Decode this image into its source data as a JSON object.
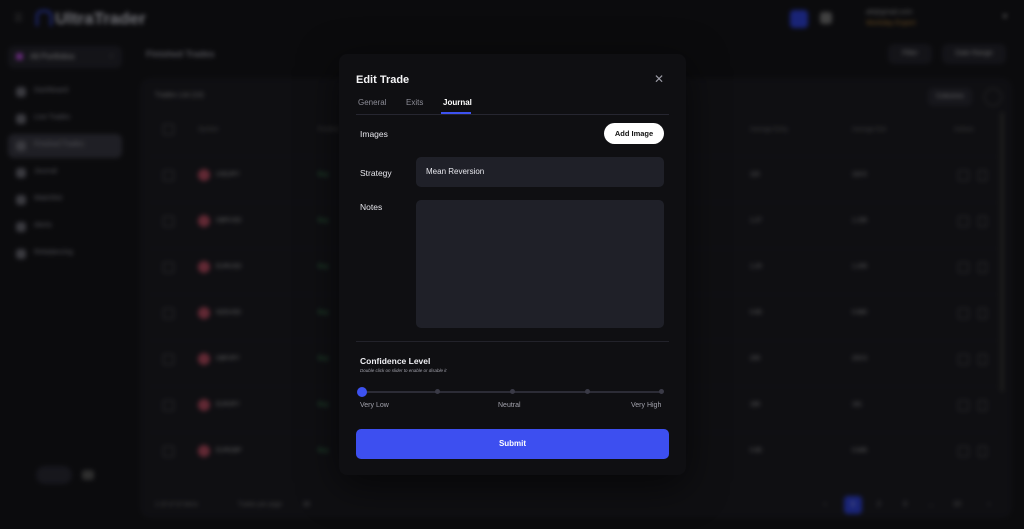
{
  "app": {
    "brand": "UltraTrader",
    "user_email": "alt@gmail.com",
    "user_plan": "Workday Expert",
    "portfolio": "All Portfolios",
    "page_title": "Finished Trades",
    "header_buttons": [
      "Filter",
      "Date Range"
    ],
    "sidebar": [
      {
        "label": "Dashboard"
      },
      {
        "label": "Live Trades"
      },
      {
        "label": "Finished Trades"
      },
      {
        "label": "Journal"
      },
      {
        "label": "Watchlist"
      },
      {
        "label": "Alerts"
      },
      {
        "label": "Rebalancing"
      }
    ],
    "table": {
      "title": "Trades List (10)",
      "columns_button": "Columns",
      "headers": [
        "Symbol",
        "Position",
        "Average Entry",
        "Average Exit",
        "Actions"
      ],
      "rows": [
        {
          "symbol": "USDJPY",
          "side": "Buy",
          "entry": "115",
          "exit": "116.5"
        },
        {
          "symbol": "GBPUSD",
          "side": "Buy",
          "entry": "1.27",
          "exit": "1.235"
        },
        {
          "symbol": "EURUSD",
          "side": "Buy",
          "entry": "1.20",
          "exit": "1.205"
        },
        {
          "symbol": "NZDUSD",
          "side": "Buy",
          "entry": "0.65",
          "exit": "0.660"
        },
        {
          "symbol": "GBPJPY",
          "side": "Buy",
          "entry": "205",
          "exit": "203.5"
        },
        {
          "symbol": "EURJPY",
          "side": "Buy",
          "entry": "165",
          "exit": "161"
        },
        {
          "symbol": "EURGBP",
          "side": "Buy",
          "entry": "0.85",
          "exit": "0.845"
        }
      ],
      "pagination_text": "1-10 of 10 items",
      "rows_per_page_label": "Trades per page",
      "rows_per_page_value": "10",
      "pages": [
        "1",
        "2",
        "3",
        "...",
        "10"
      ]
    }
  },
  "modal": {
    "title": "Edit Trade",
    "tabs": [
      {
        "label": "General"
      },
      {
        "label": "Exits"
      },
      {
        "label": "Journal"
      }
    ],
    "active_tab": "Journal",
    "images_label": "Images",
    "add_image_label": "Add Image",
    "strategy_label": "Strategy",
    "strategy_value": "Mean Reversion",
    "notes_label": "Notes",
    "notes_value": "",
    "confidence": {
      "title": "Confidence Level",
      "hint": "Double click on slider to enable or disable it",
      "labels": [
        "Very Low",
        "Neutral",
        "Very High"
      ],
      "value_fraction": 0
    },
    "submit_label": "Submit"
  },
  "colors": {
    "accent": "#3d4ff0",
    "modal_bg": "#0f0f12",
    "input_bg": "#1f2028"
  }
}
